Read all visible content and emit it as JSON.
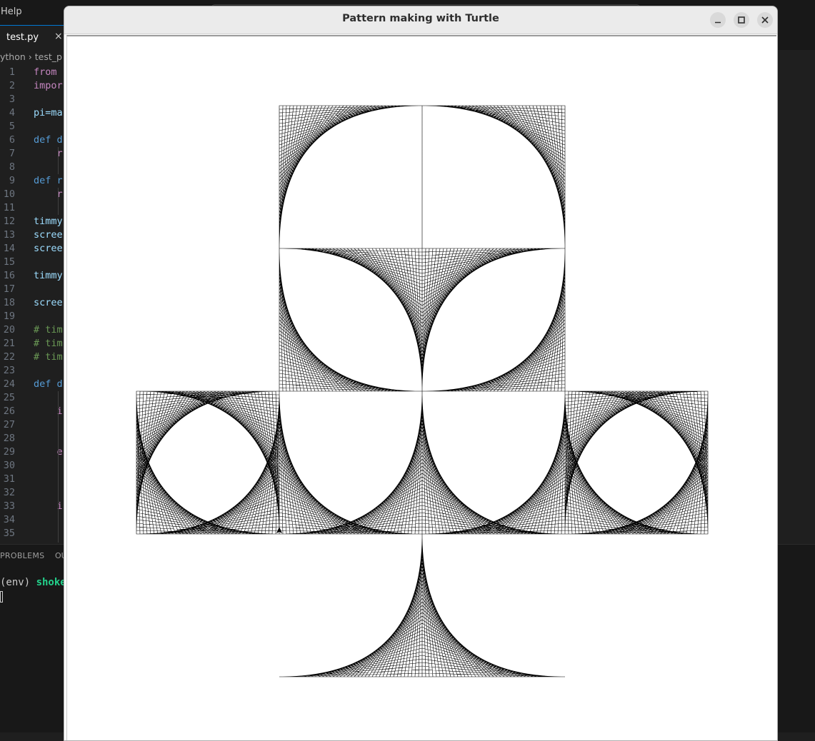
{
  "editor": {
    "menu": {
      "help": "Help"
    },
    "tab": {
      "label": "test.py",
      "close": "×"
    },
    "breadcrumb": {
      "part1": "ython",
      "separator": "›",
      "part2": "test_p"
    },
    "code_lines": [
      {
        "num": "1",
        "text": "from",
        "color": "#c586c0"
      },
      {
        "num": "2",
        "text": "impor",
        "color": "#c586c0"
      },
      {
        "num": "3",
        "text": "",
        "color": "#d4d4d4"
      },
      {
        "num": "4",
        "text": "pi=ma",
        "color": "#9cdcfe"
      },
      {
        "num": "5",
        "text": "",
        "color": "#d4d4d4"
      },
      {
        "num": "6",
        "text": "def d",
        "color": "#569cd6"
      },
      {
        "num": "7",
        "text": "    r",
        "color": "#c586c0"
      },
      {
        "num": "8",
        "text": "",
        "color": "#d4d4d4"
      },
      {
        "num": "9",
        "text": "def r",
        "color": "#569cd6"
      },
      {
        "num": "10",
        "text": "    r",
        "color": "#c586c0"
      },
      {
        "num": "11",
        "text": "",
        "color": "#d4d4d4"
      },
      {
        "num": "12",
        "text": "timmy",
        "color": "#9cdcfe"
      },
      {
        "num": "13",
        "text": "scree",
        "color": "#9cdcfe"
      },
      {
        "num": "14",
        "text": "scree",
        "color": "#9cdcfe"
      },
      {
        "num": "15",
        "text": "",
        "color": "#d4d4d4"
      },
      {
        "num": "16",
        "text": "timmy",
        "color": "#9cdcfe"
      },
      {
        "num": "17",
        "text": "",
        "color": "#d4d4d4"
      },
      {
        "num": "18",
        "text": "scree",
        "color": "#9cdcfe"
      },
      {
        "num": "19",
        "text": "",
        "color": "#d4d4d4"
      },
      {
        "num": "20",
        "text": "# tim",
        "color": "#6a9955"
      },
      {
        "num": "21",
        "text": "# tim",
        "color": "#6a9955"
      },
      {
        "num": "22",
        "text": "# tim",
        "color": "#6a9955"
      },
      {
        "num": "23",
        "text": "",
        "color": "#d4d4d4"
      },
      {
        "num": "24",
        "text": "def d",
        "color": "#569cd6"
      },
      {
        "num": "25",
        "text": "",
        "color": "#d4d4d4"
      },
      {
        "num": "26",
        "text": "    i",
        "color": "#c586c0"
      },
      {
        "num": "27",
        "text": "",
        "color": "#d4d4d4"
      },
      {
        "num": "28",
        "text": "",
        "color": "#d4d4d4"
      },
      {
        "num": "29",
        "text": "    e",
        "color": "#c586c0"
      },
      {
        "num": "30",
        "text": "",
        "color": "#d4d4d4"
      },
      {
        "num": "31",
        "text": "",
        "color": "#d4d4d4"
      },
      {
        "num": "32",
        "text": "",
        "color": "#d4d4d4"
      },
      {
        "num": "33",
        "text": "    i",
        "color": "#c586c0"
      },
      {
        "num": "34",
        "text": "",
        "color": "#d4d4d4"
      },
      {
        "num": "35",
        "text": "",
        "color": "#d4d4d4"
      }
    ],
    "panel": {
      "problems_tab": "PROBLEMS",
      "output_tab": "OU"
    },
    "terminal": {
      "env": "(env) ",
      "user": "shokee"
    }
  },
  "turtle_window": {
    "title": "Pattern making with Turtle",
    "controls": {
      "minimize_icon": "window-minimize-icon",
      "maximize_icon": "window-maximize-icon",
      "close_icon": "window-close-icon"
    },
    "canvas": {
      "background": "#ffffff",
      "stroke": "#000000",
      "lines_per_curve": 40
    }
  }
}
